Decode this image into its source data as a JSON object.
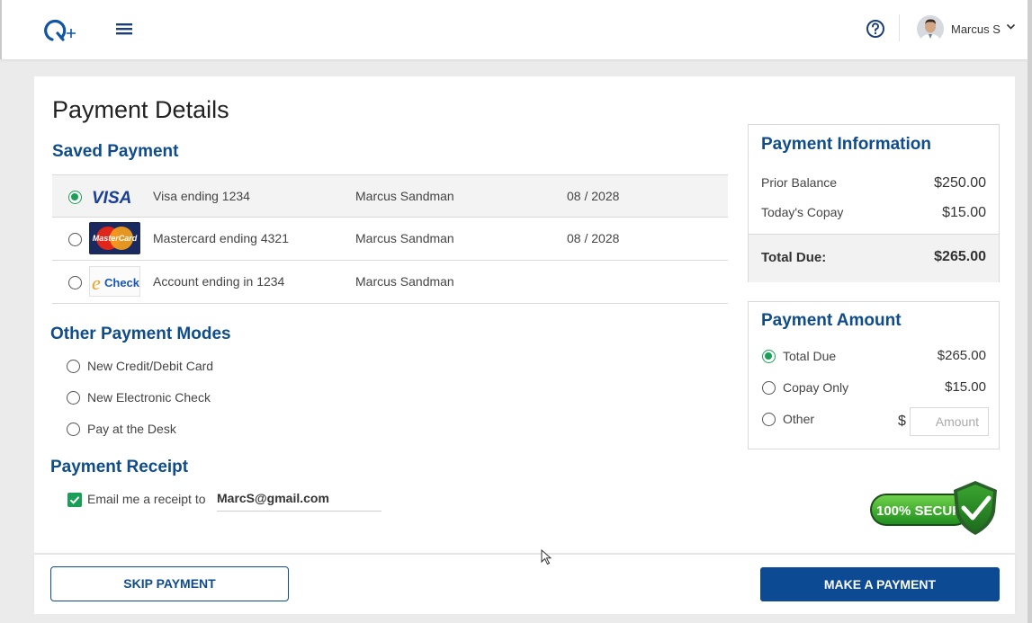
{
  "header": {
    "user_name": "Marcus S"
  },
  "page_title": "Payment Details",
  "saved_payment": {
    "title": "Saved Payment",
    "rows": [
      {
        "brand": "VISA",
        "label": "Visa ending 1234",
        "name": "Marcus Sandman",
        "expiry": "08 / 2028",
        "selected": true
      },
      {
        "brand": "MasterCard",
        "label": "Mastercard ending 4321",
        "name": "Marcus Sandman",
        "expiry": "08 / 2028",
        "selected": false
      },
      {
        "brand_prefix": "e",
        "brand": "Check",
        "label": "Account ending in 1234",
        "name": "Marcus Sandman",
        "expiry": "",
        "selected": false
      }
    ]
  },
  "other_modes": {
    "title": "Other Payment Modes",
    "options": [
      "New Credit/Debit Card",
      "New Electronic Check",
      "Pay at the Desk"
    ]
  },
  "receipt": {
    "title": "Payment Receipt",
    "checkbox_label": "Email me a receipt to",
    "email": "MarcS@gmail.com",
    "checked": true
  },
  "payment_info": {
    "title": "Payment Information",
    "prior_balance_label": "Prior Balance",
    "prior_balance": "$250.00",
    "copay_label": "Today's Copay",
    "copay": "$15.00",
    "total_label": "Total Due:",
    "total": "$265.00"
  },
  "payment_amount": {
    "title": "Payment Amount",
    "options": [
      {
        "label": "Total Due",
        "value": "$265.00",
        "selected": true
      },
      {
        "label": "Copay Only",
        "value": "$15.00",
        "selected": false
      },
      {
        "label": "Other",
        "value": "",
        "selected": false
      }
    ],
    "currency_symbol": "$",
    "amount_placeholder": "Amount"
  },
  "badge_text": "100% SECURE",
  "buttons": {
    "skip": "SKIP PAYMENT",
    "pay": "MAKE A PAYMENT"
  },
  "colors": {
    "accent": "#0f4c8c",
    "success": "#1a9e58",
    "primary_button": "#0d4a94"
  }
}
